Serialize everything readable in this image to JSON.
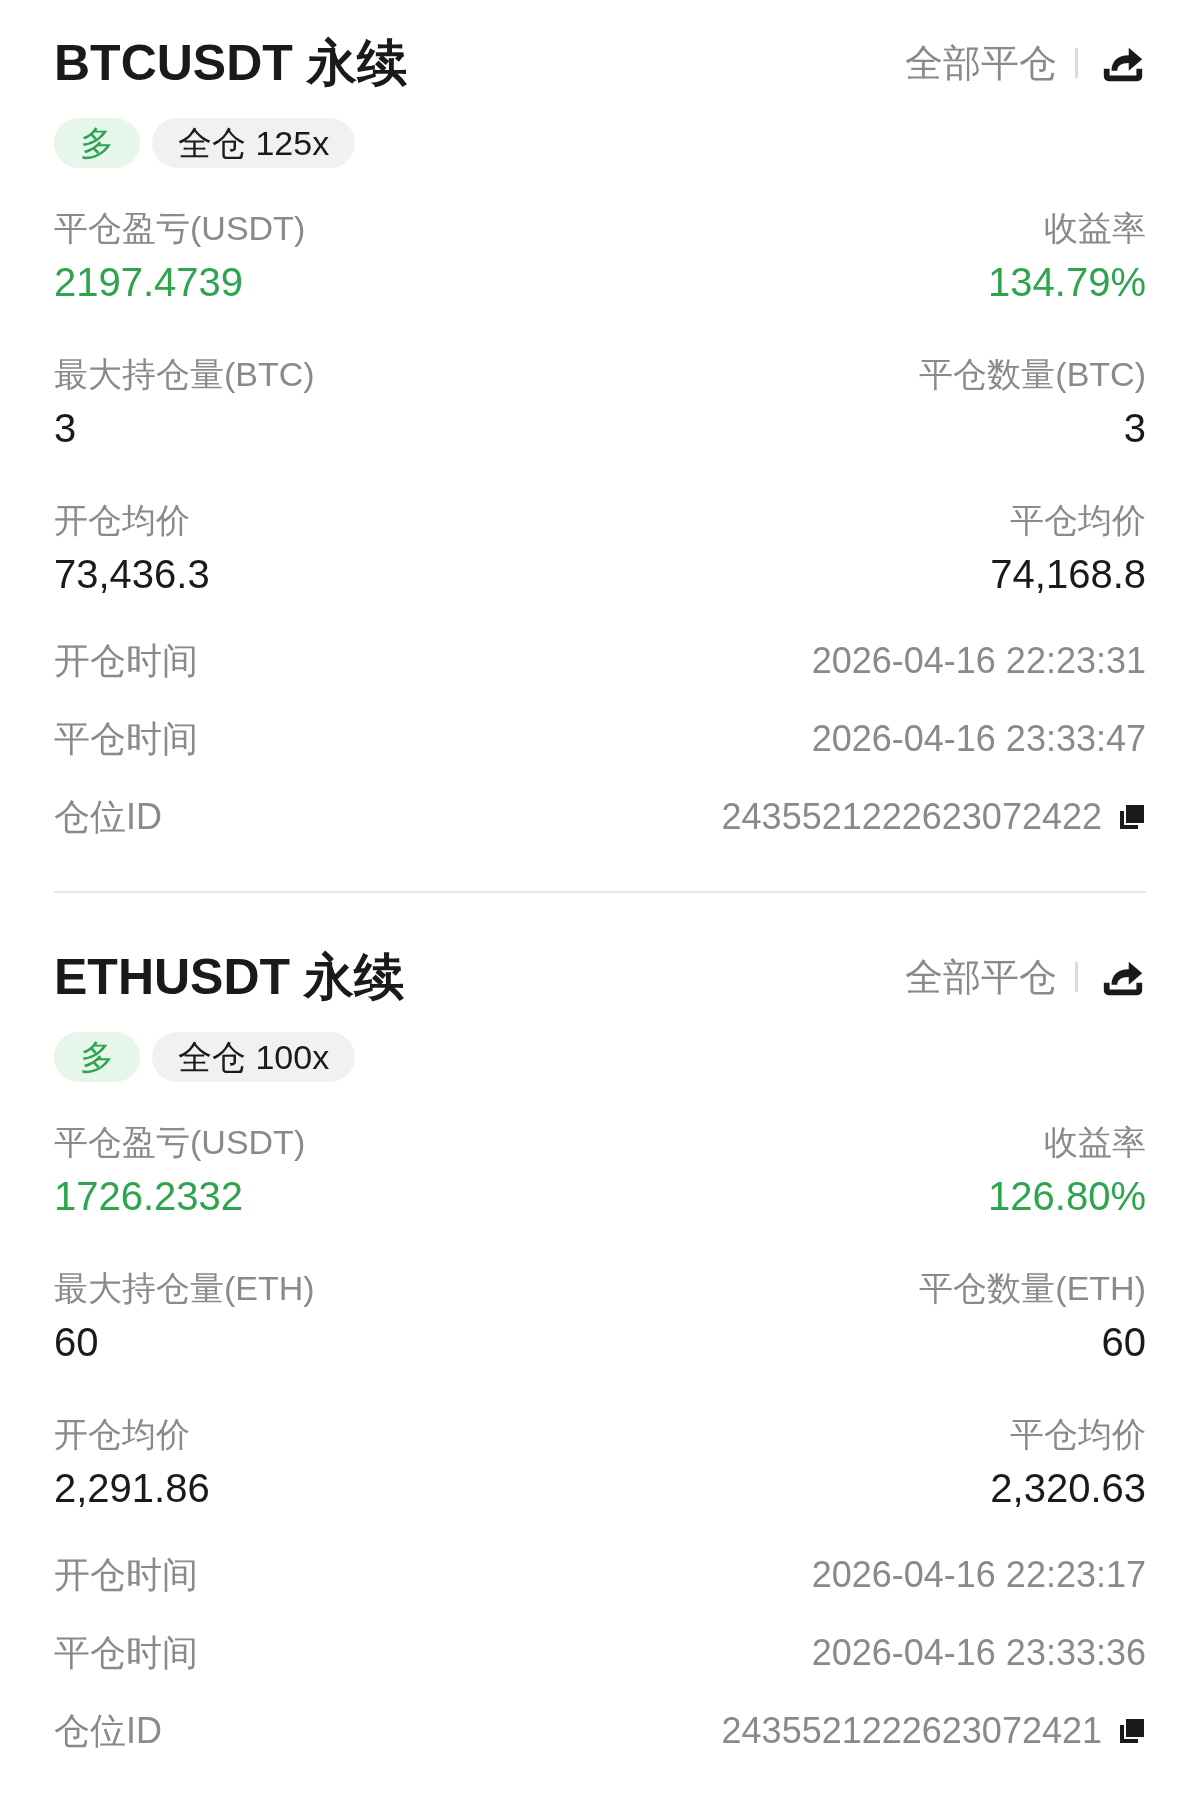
{
  "positions": [
    {
      "symbol": "BTCUSDT 永续",
      "close_all": "全部平仓",
      "tags": [
        {
          "kind": "side",
          "label": "多"
        },
        {
          "kind": "margin",
          "label": "全仓 125x"
        }
      ],
      "stats": [
        {
          "left": {
            "label": "平仓盈亏(USDT)",
            "value": "2197.4739",
            "kind": "pnl"
          },
          "right": {
            "label": "收益率",
            "value": "134.79%",
            "kind": "pnl"
          }
        },
        {
          "left": {
            "label": "最大持仓量(BTC)",
            "value": "3",
            "kind": "plain"
          },
          "right": {
            "label": "平仓数量(BTC)",
            "value": "3",
            "kind": "plain"
          }
        },
        {
          "left": {
            "label": "开仓均价",
            "value": "73,436.3",
            "kind": "plain"
          },
          "right": {
            "label": "平仓均价",
            "value": "74,168.8",
            "kind": "plain"
          }
        }
      ],
      "details": [
        {
          "label": "开仓时间",
          "value": "2026-04-16 22:23:31",
          "copyable": false
        },
        {
          "label": "平仓时间",
          "value": "2026-04-16 23:33:47",
          "copyable": false
        },
        {
          "label": "仓位ID",
          "value": "2435521222623072422",
          "copyable": true
        }
      ]
    },
    {
      "symbol": "ETHUSDT 永续",
      "close_all": "全部平仓",
      "tags": [
        {
          "kind": "side",
          "label": "多"
        },
        {
          "kind": "margin",
          "label": "全仓 100x"
        }
      ],
      "stats": [
        {
          "left": {
            "label": "平仓盈亏(USDT)",
            "value": "1726.2332",
            "kind": "pnl"
          },
          "right": {
            "label": "收益率",
            "value": "126.80%",
            "kind": "pnl"
          }
        },
        {
          "left": {
            "label": "最大持仓量(ETH)",
            "value": "60",
            "kind": "plain"
          },
          "right": {
            "label": "平仓数量(ETH)",
            "value": "60",
            "kind": "plain"
          }
        },
        {
          "left": {
            "label": "开仓均价",
            "value": "2,291.86",
            "kind": "plain"
          },
          "right": {
            "label": "平仓均价",
            "value": "2,320.63",
            "kind": "plain"
          }
        }
      ],
      "details": [
        {
          "label": "开仓时间",
          "value": "2026-04-16 22:23:17",
          "copyable": false
        },
        {
          "label": "平仓时间",
          "value": "2026-04-16 23:33:36",
          "copyable": false
        },
        {
          "label": "仓位ID",
          "value": "2435521222623072421",
          "copyable": true
        }
      ]
    }
  ]
}
